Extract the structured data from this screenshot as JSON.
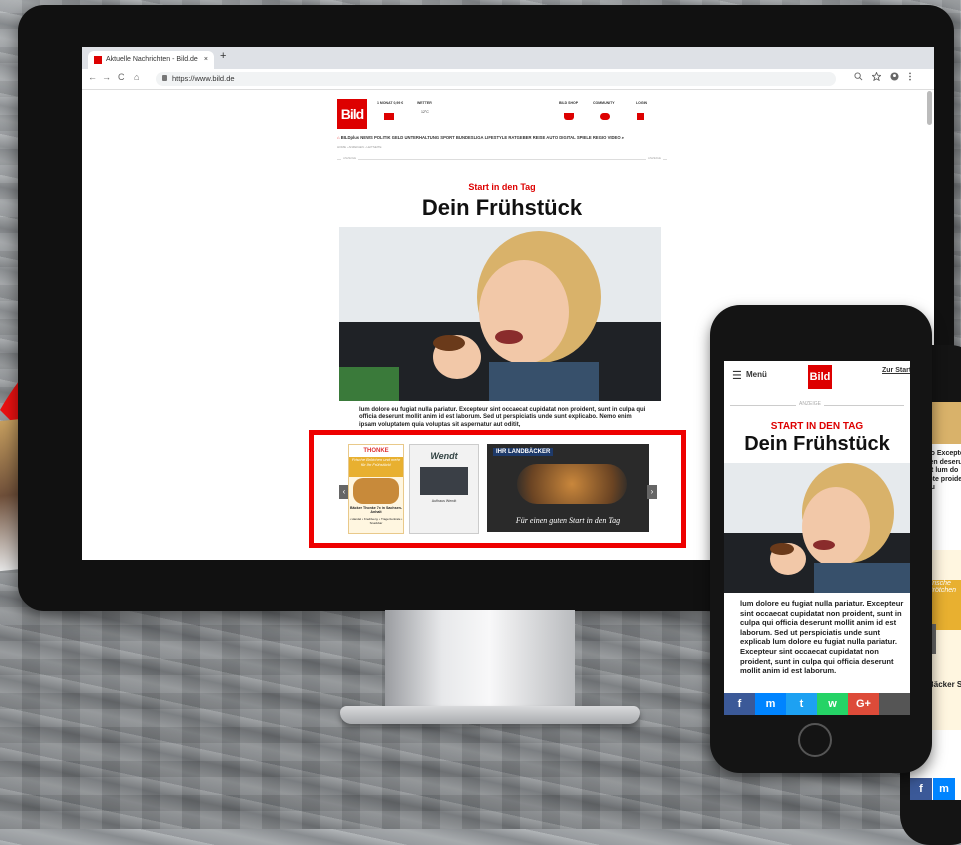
{
  "browser": {
    "tab_title": "Aktuelle Nachrichten - Bild.de",
    "tab_close": "×",
    "new_tab": "+",
    "url": "https://www.bild.de",
    "nav_back": "←",
    "nav_forward": "→",
    "nav_reload": "C",
    "nav_home": "⌂",
    "icons": [
      "search-icon",
      "star-icon",
      "account-icon",
      "menu-dots-icon"
    ]
  },
  "desktop_page": {
    "logo": "Bild",
    "header_items": [
      "1 MONAT 0,99 €",
      "WETTER",
      "BILD SHOP",
      "COMMUNITY",
      "LOGIN"
    ],
    "weather_temp": "12°C",
    "menu_items": [
      "BILDplus",
      "NEWS",
      "POLITIK",
      "GELD",
      "UNTERHALTUNG",
      "SPORT",
      "BUNDESLIGA",
      "LIFESTYLE",
      "RATGEBER",
      "REISE",
      "AUTO",
      "DIGITAL",
      "SPIELE",
      "REGIO",
      "VIDEO"
    ],
    "breadcrumb": "HOME › ANZEIGEN › LEITSEITE",
    "anzeige_left": "ANZEIGE",
    "anzeige_right": "ANZEIGE",
    "kicker": "Start in den Tag",
    "title": "Dein Frühstück",
    "body": "lum dolore eu fugiat nulla pariatur. Excepteur sint occaecat cupidatat non proident, sunt in culpa qui officia deserunt mollit anim id est laborum. Sed ut perspiciatis unde sunt explicabo. Nemo enim ipsam voluptatem quia voluptas sit aspernatur aut oditit,",
    "carousel": {
      "prev": "‹",
      "next": "›",
      "slide1_brand": "THONKE",
      "slide1_script": "Frische Brötchen und mehr für Ihr Frühstück!",
      "slide1_caption": "Bäcker Thonke 7x in Sachsen-Anhalt",
      "slide1_bullets": "• Handel • Kreditverg. • Tragerzentrale • Snackbar",
      "slide2_brand": "Wendt",
      "slide2_caption": "Aufhaus Wendt",
      "slide3_brand": "IHR LANDBÄCKER",
      "slide3_script": "Für einen guten Start in den Tag"
    }
  },
  "phone1": {
    "menu_label": "Menü",
    "logo": "Bild",
    "link": "Zur Startseite Home",
    "anzeige": "ANZEIGE",
    "kicker": "START IN DEN TAG",
    "title": "Dein Frühstück",
    "body": "lum dolore eu fugiat nulla pariatur. Excepteur sint occaecat cupidatat non proident, sunt in culpa qui officia deserunt mollit anim id est laborum. Sed ut perspiciatis unde sunt explicab lum dolore eu fugiat nulla pariatur. Excepteur sint occaecat cupidatat non proident, sunt in culpa qui officia deserunt mollit anim id est laborum.",
    "social": [
      "f",
      "m",
      "t",
      "w",
      "G+"
    ]
  },
  "phone2": {
    "body": "lum do Excepte proiden deseru Sed ut lum do Excepte proiden deseru",
    "ad_script": "Frische Brötchen",
    "ad_caption": "Bäcker S",
    "social": [
      "f",
      "m"
    ]
  },
  "colors": {
    "bild_red": "#dd0000",
    "highlight_red": "#ee0000",
    "facebook": "#3b5998",
    "messenger": "#0084ff",
    "twitter": "#1da1f2",
    "whatsapp": "#25d366",
    "googleplus": "#dd4b39"
  }
}
